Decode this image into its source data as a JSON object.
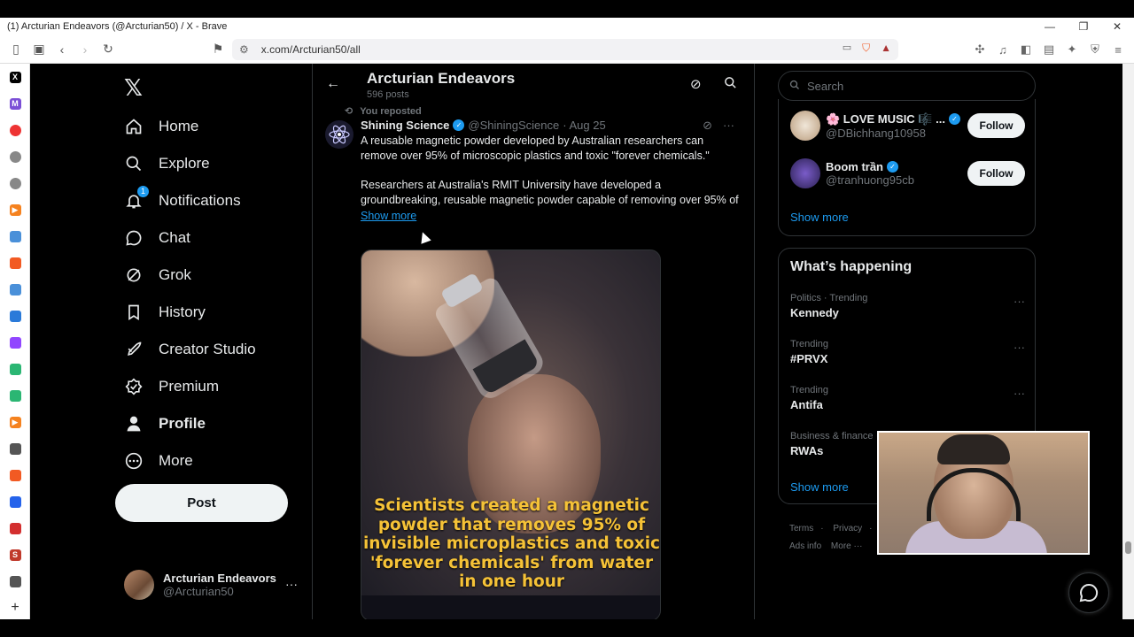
{
  "browser": {
    "window_title": "(1) Arcturian Endeavors (@Arcturian50) / X - Brave",
    "url": "x.com/Arcturian50/all"
  },
  "nav": {
    "items": [
      {
        "label": "Home",
        "icon": "home-icon"
      },
      {
        "label": "Explore",
        "icon": "search-icon"
      },
      {
        "label": "Notifications",
        "icon": "bell-icon",
        "badge": "1"
      },
      {
        "label": "Chat",
        "icon": "chat-icon"
      },
      {
        "label": "Grok",
        "icon": "grok-icon"
      },
      {
        "label": "History",
        "icon": "bookmark-icon"
      },
      {
        "label": "Creator Studio",
        "icon": "rocket-icon"
      },
      {
        "label": "Premium",
        "icon": "premium-icon"
      },
      {
        "label": "Profile",
        "icon": "person-icon"
      },
      {
        "label": "More",
        "icon": "more-circle-icon"
      }
    ],
    "post_label": "Post",
    "account": {
      "name": "Arcturian Endeavors",
      "handle": "@Arcturian50",
      "dots": "···"
    }
  },
  "profile_header": {
    "name": "Arcturian Endeavors",
    "posts": "596 posts"
  },
  "tweet": {
    "repost_label": "You reposted",
    "author": "Shining Science",
    "handle": "@ShiningScience",
    "date": "· Aug 25",
    "text1": "A reusable magnetic powder developed by Australian researchers can remove over 95% of microscopic plastics and toxic \"forever chemicals.\"",
    "text2": "Researchers at Australia's RMIT University have developed a groundbreaking, reusable magnetic powder capable of removing over 95% of",
    "show_more": "Show more",
    "image_caption": "Scientists created a magnetic powder that removes 95% of invisible microplastics and toxic 'forever chemicals' from water in one hour"
  },
  "search": {
    "placeholder": "Search"
  },
  "who_to_follow": {
    "items": [
      {
        "name": "🌸 LOVE MUSIC 🎼 ...",
        "handle": "@DBichhang10958",
        "button": "Follow"
      },
      {
        "name": "Boom trần",
        "handle": "@tranhuong95cb",
        "button": "Follow"
      }
    ],
    "show_more": "Show more"
  },
  "happening": {
    "title": "What’s happening",
    "trends": [
      {
        "context": "Politics · Trending",
        "title": "Kennedy"
      },
      {
        "context": "Trending",
        "title": "#PRVX"
      },
      {
        "context": "Trending",
        "title": "Antifa"
      },
      {
        "context": "Business & finance ·",
        "title": "RWAs"
      }
    ],
    "show_more": "Show more"
  },
  "footer": {
    "terms": "Terms",
    "privacy": "Privacy",
    "ads": "Ads info",
    "more": "More ···"
  },
  "colors": {
    "accent": "#1d9bf0",
    "bg": "#000000",
    "border": "#2f3336",
    "muted": "#71767b",
    "caption": "#f5c237"
  }
}
